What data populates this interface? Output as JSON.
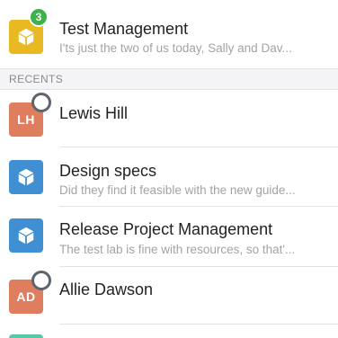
{
  "conversations": {
    "pinned": {
      "title": "Test Management",
      "preview": "I'ts just the two of us today, Sally and Dav...",
      "badge_count": "3",
      "avatar_icon": "cube-icon",
      "avatar_color": "#e8b923"
    },
    "recents_header": "RECENTS",
    "recents": [
      {
        "title": "Lewis Hill",
        "initials": "LH",
        "avatar_color": "#df7e5e",
        "presence": "offline"
      },
      {
        "title": "Design specs",
        "preview": "Did they find it feasible with the new guide...",
        "avatar_icon": "cube-icon",
        "avatar_color": "#3f8fd2"
      },
      {
        "title": "Release Project Management",
        "preview": "The test lab is fine with resources, so that'...",
        "avatar_icon": "cube-icon",
        "avatar_color": "#3f8fd2"
      },
      {
        "title": "Allie Dawson",
        "initials": "AD",
        "avatar_color": "#df7e5e",
        "presence": "offline"
      }
    ]
  }
}
